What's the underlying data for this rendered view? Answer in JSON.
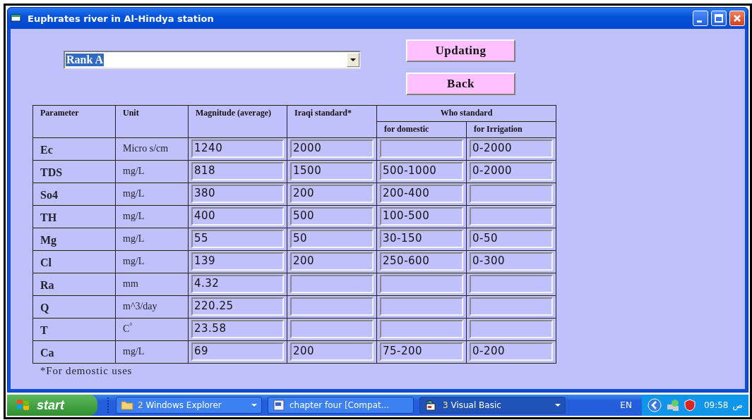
{
  "window": {
    "title": "Euphrates river in Al-Hindya station"
  },
  "rank_select": {
    "value": "Rank A"
  },
  "buttons": [
    {
      "label": "Updating"
    },
    {
      "label": "Back"
    }
  ],
  "table": {
    "headers": {
      "parameter": "Parameter",
      "unit": "Unit",
      "magnitude": "Magnitude (average)",
      "iraqi": "Iraqi standard*",
      "who": "Who standard",
      "who_domestic": "for domestic",
      "who_irrigation": "for Irrigation"
    },
    "rows": [
      {
        "parameter": "Ec",
        "unit": "Micro s/cm",
        "magnitude": "1240",
        "iraqi": "2000",
        "who_irrigation": "0-2000"
      },
      {
        "parameter": "TDS",
        "unit": "mg/L",
        "magnitude": "818",
        "iraqi": "1500",
        "who_domestic": "500-1000",
        "who_irrigation": "0-2000"
      },
      {
        "parameter": "So4",
        "unit": "mg/L",
        "magnitude": "380",
        "iraqi": "200",
        "who_domestic": "200-400"
      },
      {
        "parameter": "TH",
        "unit": "mg/L",
        "magnitude": "400",
        "iraqi": "500",
        "who_domestic": "100-500"
      },
      {
        "parameter": "Mg",
        "unit": "mg/L",
        "magnitude": "55",
        "iraqi": "50",
        "who_domestic": "30-150",
        "who_irrigation": "0-50"
      },
      {
        "parameter": "Cl",
        "unit": "mg/L",
        "magnitude": "139",
        "iraqi": "200",
        "who_domestic": "250-600",
        "who_irrigation": "0-300"
      },
      {
        "parameter": "Ra",
        "unit": "mm",
        "magnitude": "4.32"
      },
      {
        "parameter": "Q",
        "unit": "m^3/day",
        "magnitude": "220.25"
      },
      {
        "parameter": "T",
        "unit": "C$^{°}$",
        "magnitude": "23.58"
      },
      {
        "parameter": "Ca",
        "unit": "mg/L",
        "magnitude": "69",
        "iraqi": "200",
        "who_domestic": "75-200",
        "who_irrigation": "0-200"
      }
    ]
  },
  "footnote": "*For demostic uses",
  "taskbar": {
    "start": "start",
    "items": [
      {
        "kind": "folder",
        "count": "2",
        "label": "Windows Explorer",
        "group": true,
        "selected": false
      },
      {
        "kind": "document",
        "label": "chapter four [Compat...",
        "group": false,
        "selected": false
      },
      {
        "kind": "app",
        "count": "3",
        "label": "Visual Basic",
        "group": true,
        "selected": true
      }
    ],
    "language": "EN",
    "time": "09:58",
    "period": "ص"
  }
}
